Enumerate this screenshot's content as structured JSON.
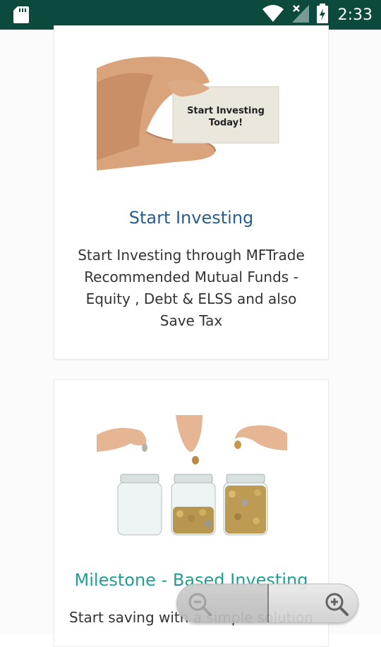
{
  "status_bar": {
    "time": "2:33",
    "icons": [
      "sd-card-icon",
      "wifi-icon",
      "no-signal-icon",
      "battery-charging-icon"
    ]
  },
  "cards": [
    {
      "image_caption": "Start Investing Today!",
      "image_icon": "hand-holding-card-image",
      "title": "Start Investing",
      "description": "Start Investing through MFTrade Recommended Mutual Funds - Equity , Debt & ELSS and also Save Tax"
    },
    {
      "image_icon": "coins-jars-image",
      "title": "Milestone - Based Investing",
      "description": "Start saving with a simple solution"
    }
  ],
  "zoom_control": {
    "zoom_out_icon": "zoom-out-icon",
    "zoom_in_icon": "zoom-in-icon"
  },
  "colors": {
    "status_bar": "#0c4a3d",
    "card1_title": "#2a5d8a",
    "card2_title": "#1f9e91"
  }
}
